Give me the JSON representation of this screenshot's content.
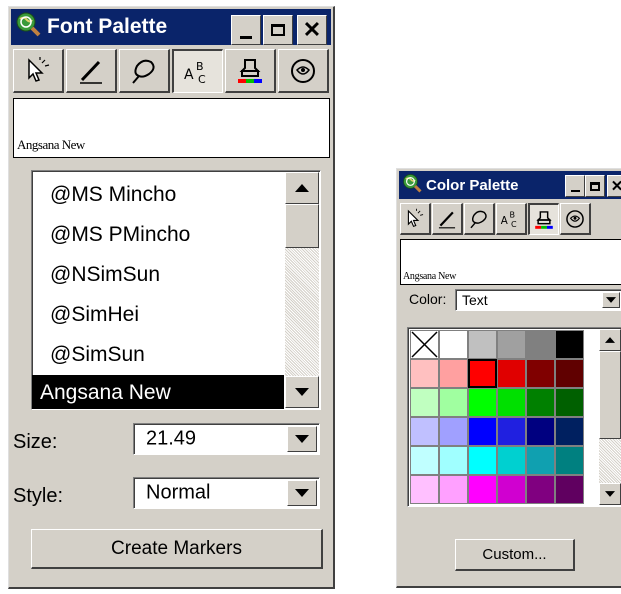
{
  "font_palette": {
    "title": "Font Palette",
    "tools": [
      "pointer-tool-icon",
      "pen-tool-icon",
      "brush-tool-icon",
      "text-tool-icon",
      "fill-color-tool-icon",
      "symbol-tool-icon"
    ],
    "pressed_tool": 3,
    "preview_text": "Angsana New",
    "font_list": [
      "@MS Mincho",
      "@MS PMincho",
      "@NSimSun",
      "@SimHei",
      "@SimSun",
      "Angsana New"
    ],
    "selected_font_index": 5,
    "size_label": "Size:",
    "size_value": "21.49",
    "style_label": "Style:",
    "style_value": "Normal",
    "create_button": "Create Markers"
  },
  "color_palette": {
    "title": "Color Palette",
    "tools": [
      "pointer-tool-icon",
      "pen-tool-icon",
      "brush-tool-icon",
      "text-tool-icon",
      "fill-color-tool-icon",
      "symbol-tool-icon"
    ],
    "pressed_tool": 4,
    "preview_text": "Angsana New",
    "color_label": "Color:",
    "color_target": "Text",
    "selected_swatch": "#ff0000",
    "swatches": [
      [
        "none",
        "#ffffff",
        "#c0c0c0",
        "#a0a0a0",
        "#808080",
        "#000000"
      ],
      [
        "#ffc0c0",
        "#ffa0a0",
        "#ff0000",
        "#e00000",
        "#800000",
        "#600000"
      ],
      [
        "#c0ffc0",
        "#a0ffa0",
        "#00ff00",
        "#00e000",
        "#008000",
        "#006000"
      ],
      [
        "#c0c0ff",
        "#a0a0ff",
        "#0000ff",
        "#2020e0",
        "#000080",
        "#002060"
      ],
      [
        "#c0ffff",
        "#a0ffff",
        "#00ffff",
        "#00d0d0",
        "#10a0b0",
        "#008080"
      ],
      [
        "#ffc0ff",
        "#ffa0ff",
        "#ff00ff",
        "#d000d0",
        "#800080",
        "#600060"
      ]
    ],
    "custom_button": "Custom..."
  }
}
